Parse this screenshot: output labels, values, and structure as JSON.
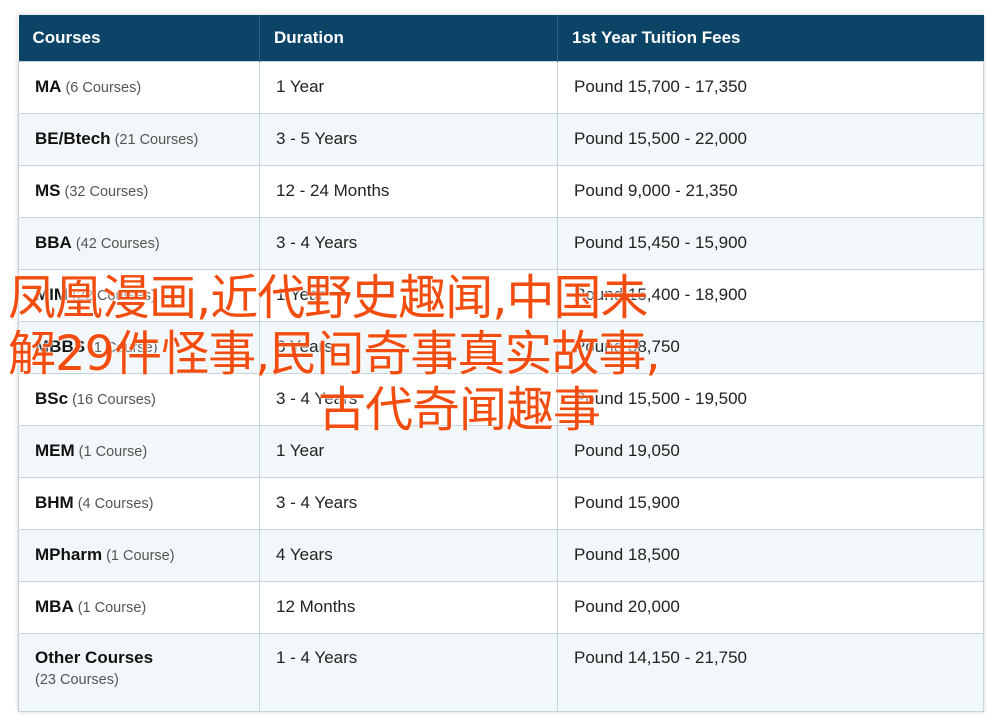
{
  "table": {
    "headers": [
      "Courses",
      "Duration",
      "1st Year Tuition Fees"
    ],
    "rows": [
      {
        "course": "MA",
        "count": "(6 Courses)",
        "duration": "1 Year",
        "fees": "Pound 15,700 - 17,350"
      },
      {
        "course": "BE/Btech",
        "count": "(21 Courses)",
        "duration": "3 - 5 Years",
        "fees": "Pound 15,500 - 22,000"
      },
      {
        "course": "MS",
        "count": "(32 Courses)",
        "duration": "12 - 24 Months",
        "fees": "Pound 9,000 - 21,350"
      },
      {
        "course": "BBA",
        "count": "(42 Courses)",
        "duration": "3 - 4 Years",
        "fees": "Pound 15,450 - 15,900"
      },
      {
        "course": "MIM",
        "count": "(22 Courses)",
        "duration": "1 Year",
        "fees": "Pound 15,400 - 18,900"
      },
      {
        "course": "MBBS",
        "count": "(1 Course)",
        "duration": "6 Years",
        "fees": "Pound 38,750"
      },
      {
        "course": "BSc",
        "count": "(16 Courses)",
        "duration": "3 - 4 Years",
        "fees": "Pound 15,500 - 19,500"
      },
      {
        "course": "MEM",
        "count": "(1 Course)",
        "duration": "1 Year",
        "fees": "Pound 19,050"
      },
      {
        "course": "BHM",
        "count": "(4 Courses)",
        "duration": "3 - 4 Years",
        "fees": "Pound 15,900"
      },
      {
        "course": "MPharm",
        "count": "(1 Course)",
        "duration": "4 Years",
        "fees": "Pound 18,500"
      },
      {
        "course": "MBA",
        "count": "(1 Course)",
        "duration": "12 Months",
        "fees": "Pound 20,000"
      },
      {
        "course": "Other Courses",
        "count": "(23 Courses)",
        "duration": "1 - 4 Years",
        "fees": "Pound 14,150 - 21,750"
      }
    ]
  },
  "overlay": {
    "line1": "凤凰漫画,近代野史趣闻,中国未",
    "line2": "解29件怪事,民间奇事真实故事,",
    "line3": "古代奇闻趣事"
  },
  "colors": {
    "header_bg": "#0b4466",
    "header_text": "#ffffff",
    "row_alt_bg": "#f2f7fa",
    "border": "#c7d3dd",
    "overlay_text": "#f24d0f"
  }
}
